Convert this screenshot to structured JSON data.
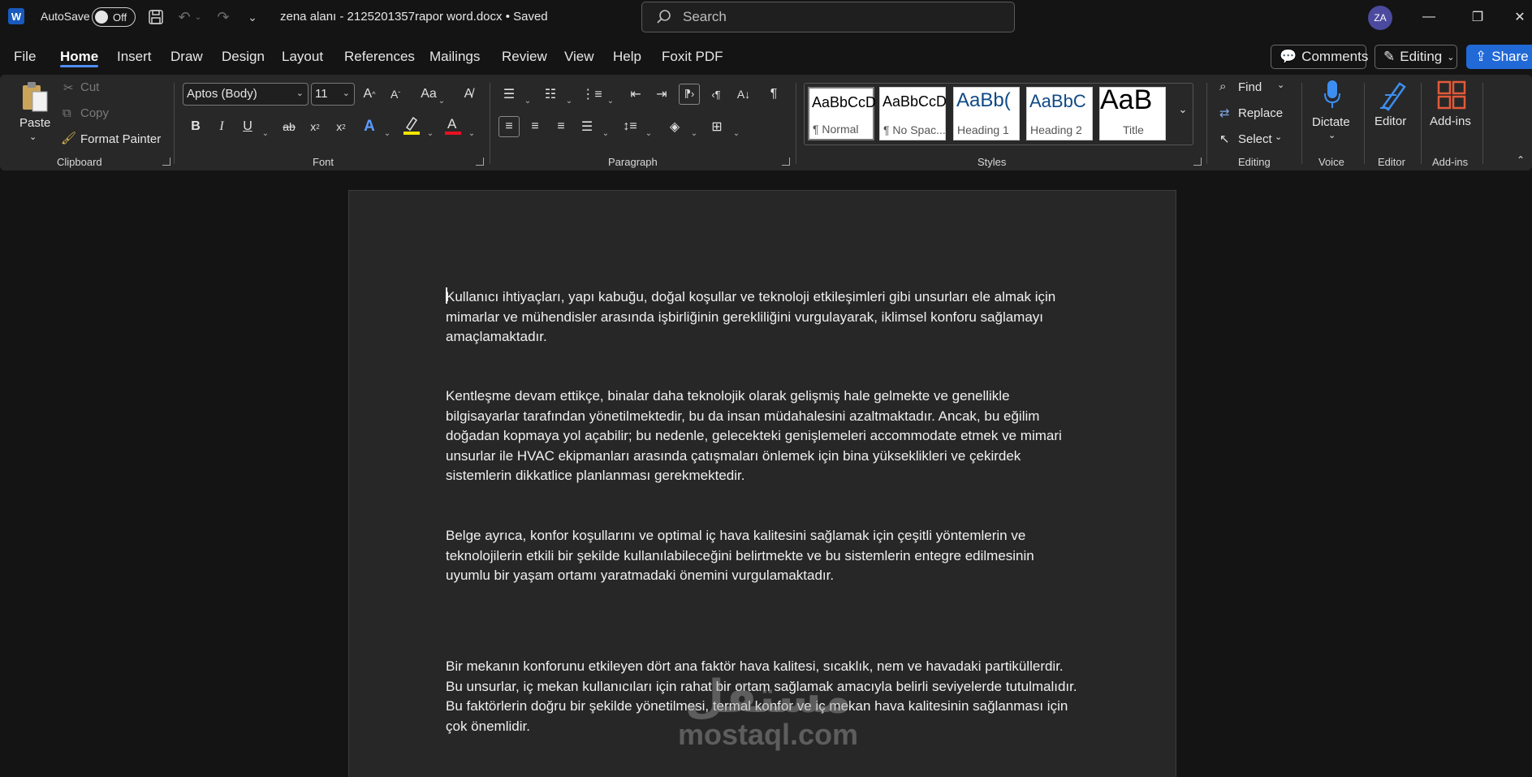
{
  "titlebar": {
    "app_logo": "W",
    "autosave_label": "AutoSave",
    "autosave_state": "Off",
    "document_title": "zena  alanı - 2125201357rapor word.docx • Saved",
    "search_placeholder": "Search",
    "avatar_initials": "ZA",
    "icons": [
      "save-icon",
      "undo-icon",
      "redo-icon",
      "customize-quick-access-icon",
      "minimize-icon",
      "restore-icon",
      "close-icon"
    ]
  },
  "tabs": [
    "File",
    "Home",
    "Insert",
    "Draw",
    "Design",
    "Layout",
    "References",
    "Mailings",
    "Review",
    "View",
    "Help",
    "Foxit PDF"
  ],
  "active_tab": "Home",
  "top_buttons": {
    "comments": "Comments",
    "editing": "Editing",
    "share": "Share"
  },
  "ribbon": {
    "clipboard": {
      "label": "Clipboard",
      "paste": "Paste",
      "cut": "Cut",
      "copy": "Copy",
      "format_painter": "Format Painter"
    },
    "font": {
      "label": "Font",
      "font_name": "Aptos (Body)",
      "font_size": "11"
    },
    "paragraph": {
      "label": "Paragraph"
    },
    "styles": {
      "label": "Styles",
      "items": [
        {
          "sample": "AaBbCcD",
          "name": "¶ Normal"
        },
        {
          "sample": "AaBbCcD",
          "name": "¶ No Spac..."
        },
        {
          "sample": "AaBb(",
          "name": "Heading 1"
        },
        {
          "sample": "AaBbC",
          "name": "Heading 2"
        },
        {
          "sample": "AaB",
          "name": "Title"
        }
      ]
    },
    "editing": {
      "label": "Editing",
      "find": "Find",
      "replace": "Replace",
      "select": "Select"
    },
    "voice": {
      "label": "Voice",
      "dictate": "Dictate"
    },
    "editor": {
      "label": "Editor",
      "button": "Editor"
    },
    "addins": {
      "label": "Add-ins",
      "button": "Add-ins"
    },
    "accent_color": "#4f8ef7"
  },
  "document": {
    "paragraphs": [
      "Kullanıcı ihtiyaçları, yapı kabuğu, doğal koşullar ve teknoloji etkileşimleri gibi unsurları ele almak için mimarlar ve mühendisler arasında işbirliğinin gerekliliğini vurgulayarak, iklimsel konforu sağlamayı amaçlamaktadır.",
      "Kentleşme devam ettikçe, binalar daha teknolojik olarak gelişmiş hale gelmekte ve genellikle bilgisayarlar tarafından yönetilmektedir, bu da insan müdahalesini azaltmaktadır. Ancak, bu eğilim doğadan kopmaya yol açabilir; bu nedenle, gelecekteki genişlemeleri accommodate etmek ve mimari unsurlar ile HVAC ekipmanları arasında çatışmaları önlemek için bina yükseklikleri ve çekirdek sistemlerin dikkatlice planlanması gerekmektedir.",
      "Belge ayrıca, konfor koşullarını ve optimal iç hava kalitesini sağlamak için çeşitli yöntemlerin ve teknolojilerin etkili bir şekilde kullanılabileceğini belirtmekte ve bu sistemlerin entegre edilmesinin uyumlu bir yaşam ortamı yaratmadaki önemini vurgulamaktadır.",
      "Bir mekanın konforunu etkileyen dört ana faktör hava kalitesi, sıcaklık, nem ve havadaki partiküllerdir. Bu unsurlar, iç mekan kullanıcıları için rahat bir ortam sağlamak amacıyla belirli seviyelerde tutulmalıdır. Bu faktörlerin doğru bir şekilde yönetilmesi, termal konfor ve iç mekan hava kalitesinin sağlanması için çok önemlidir."
    ]
  },
  "watermark": {
    "arabic": "مستقل",
    "latin": "mostaql.com"
  }
}
